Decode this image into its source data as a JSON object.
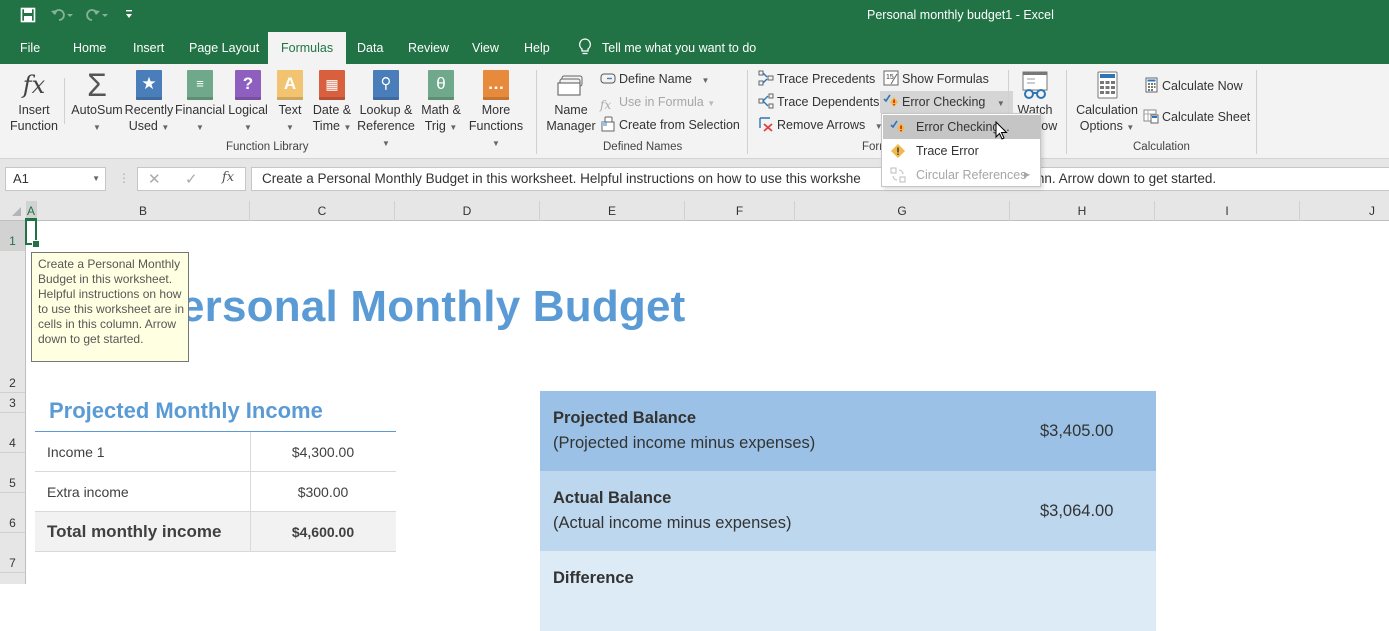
{
  "window": {
    "title": "Personal monthly budget1  -  Excel"
  },
  "qat": {
    "save": "save-icon",
    "undo": "undo-icon",
    "redo": "redo-icon",
    "customize": "customize-icon"
  },
  "tabs": [
    {
      "label": "File"
    },
    {
      "label": "Home"
    },
    {
      "label": "Insert"
    },
    {
      "label": "Page Layout"
    },
    {
      "label": "Formulas",
      "active": true
    },
    {
      "label": "Data"
    },
    {
      "label": "Review"
    },
    {
      "label": "View"
    },
    {
      "label": "Help"
    }
  ],
  "tell_me": "Tell me what you want to do",
  "ribbon": {
    "function_library": {
      "label": "Function Library",
      "insert_function": [
        "Insert",
        "Function"
      ],
      "autosum": "AutoSum",
      "recently_used": [
        "Recently",
        "Used"
      ],
      "financial": "Financial",
      "logical": "Logical",
      "text": "Text",
      "date_time": [
        "Date &",
        "Time"
      ],
      "lookup_reference": [
        "Lookup &",
        "Reference"
      ],
      "math_trig": [
        "Math &",
        "Trig"
      ],
      "more_functions": [
        "More",
        "Functions"
      ]
    },
    "defined_names": {
      "label": "Defined Names",
      "name_manager": [
        "Name",
        "Manager"
      ],
      "define_name": "Define Name",
      "use_in_formula": "Use in Formula",
      "create_from_selection": "Create from Selection"
    },
    "formula_auditing": {
      "label": "Formula Auditing",
      "label_visible": "For",
      "trace_precedents": "Trace Precedents",
      "trace_dependents": "Trace Dependents",
      "remove_arrows": "Remove Arrows",
      "show_formulas": "Show Formulas",
      "error_checking": "Error Checking",
      "watch_window": [
        "Watch",
        "Window"
      ],
      "watch_visible": [
        "Watch",
        "ow"
      ]
    },
    "calculation": {
      "label": "Calculation",
      "calculation_options": [
        "Calculation",
        "Options"
      ],
      "calculate_now": "Calculate Now",
      "calculate_sheet": "Calculate Sheet"
    }
  },
  "error_checking_menu": [
    {
      "label": "Error Checking...",
      "visible": "Error Checking...",
      "icon": "error-checking-icon",
      "hover": true
    },
    {
      "label": "Trace Error",
      "icon": "trace-error-icon"
    },
    {
      "label": "Circular References",
      "icon": "circular-references-icon",
      "disabled": true,
      "submenu": true
    }
  ],
  "formula_bar": {
    "name_box": "A1",
    "formula": "Create a Personal Monthly Budget in this worksheet. Helpful instructions on how to use this workshe",
    "formula_tail": "nn. Arrow down to get started."
  },
  "columns": [
    "A",
    "B",
    "C",
    "D",
    "E",
    "F",
    "G",
    "H",
    "I",
    "J"
  ],
  "rows": [
    "1",
    "2",
    "3",
    "4",
    "5",
    "6",
    "7"
  ],
  "sheet": {
    "title": "Personal Monthly Budget",
    "title_visible": "ersonal Monthly Budget",
    "tooltip": "Create a Personal Monthly Budget in this worksheet. Helpful instructions on how to use this worksheet are in cells in this column. Arrow down to get started.",
    "income": {
      "title": "Projected Monthly Income",
      "rows": [
        {
          "label": "Income 1",
          "value": "$4,300.00"
        },
        {
          "label": "Extra income",
          "value": "$300.00"
        },
        {
          "label": "Total monthly income",
          "value": "$4,600.00",
          "total": true
        }
      ]
    },
    "balances": [
      {
        "title": "Projected Balance",
        "subtitle": "(Projected income minus expenses)",
        "value": "$3,405.00",
        "color": "#9bc2e6"
      },
      {
        "title": "Actual Balance",
        "subtitle": "(Actual income minus expenses)",
        "value": "$3,064.00",
        "color": "#bdd7ee"
      },
      {
        "title": "Difference",
        "subtitle": "",
        "value": "",
        "color": "#ddebf7"
      }
    ]
  },
  "colors": {
    "excel_green": "#217346",
    "title_blue": "#5b9bd5"
  }
}
